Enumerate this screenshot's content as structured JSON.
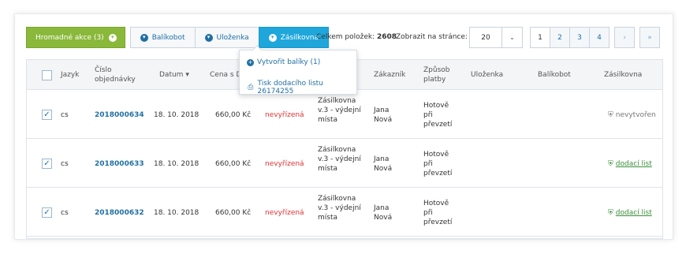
{
  "toolbar": {
    "bulk_actions_label": "Hromadné akce (3)",
    "tabs": [
      {
        "label": "Balíkobot"
      },
      {
        "label": "Uloženka"
      },
      {
        "label": "Zásilkovna"
      }
    ],
    "total_label": "Celkem položek:",
    "total_value": "2608",
    "per_page_label": "Zobrazit na stránce:",
    "per_page_value": "20",
    "pages": [
      "1",
      "2",
      "3",
      "4"
    ],
    "next": "›",
    "last": "»"
  },
  "dropdown": {
    "items": [
      {
        "label": "Vytvořit balíky (1)"
      },
      {
        "label": "Tisk dodacího listu 26174255"
      }
    ]
  },
  "table": {
    "headers": {
      "language": "Jazyk",
      "order_number": "Číslo objednávky",
      "date": "Datum",
      "price": "Cena s DPH",
      "customer": "Zákazník",
      "payment": "Způsob platby",
      "ulozenka": "Uloženka",
      "balikobot": "Balíkobot",
      "zasilkovna": "Zásilkovna"
    },
    "rows": [
      {
        "lang": "cs",
        "order": "2018000634",
        "date": "18. 10. 2018",
        "price": "660,00 Kč",
        "state": "nevyřízená",
        "shipping": "Zásilkovna v.3 - výdejní místa",
        "customer": "Jana Nová",
        "payment": "Hotově při převzetí",
        "zasilkovna": "nevytvořen"
      },
      {
        "lang": "cs",
        "order": "2018000633",
        "date": "18. 10. 2018",
        "price": "660,00 Kč",
        "state": "nevyřízená",
        "shipping": "Zásilkovna v.3 - výdejní místa",
        "customer": "Jana Nová",
        "payment": "Hotově při převzetí",
        "zasilkovna": "dodací list"
      },
      {
        "lang": "cs",
        "order": "2018000632",
        "date": "18. 10. 2018",
        "price": "660,00 Kč",
        "state": "nevyřízená",
        "shipping": "Zásilkovna v.3 - výdejní místa",
        "customer": "Jana Nová",
        "payment": "Hotově při převzetí",
        "zasilkovna": "dodací list"
      }
    ]
  },
  "colors": {
    "bulk_green": "#8ab83a",
    "active_tab": "#1fa6db",
    "link_blue": "#1f6fa3",
    "state_red": "#dd3333"
  }
}
